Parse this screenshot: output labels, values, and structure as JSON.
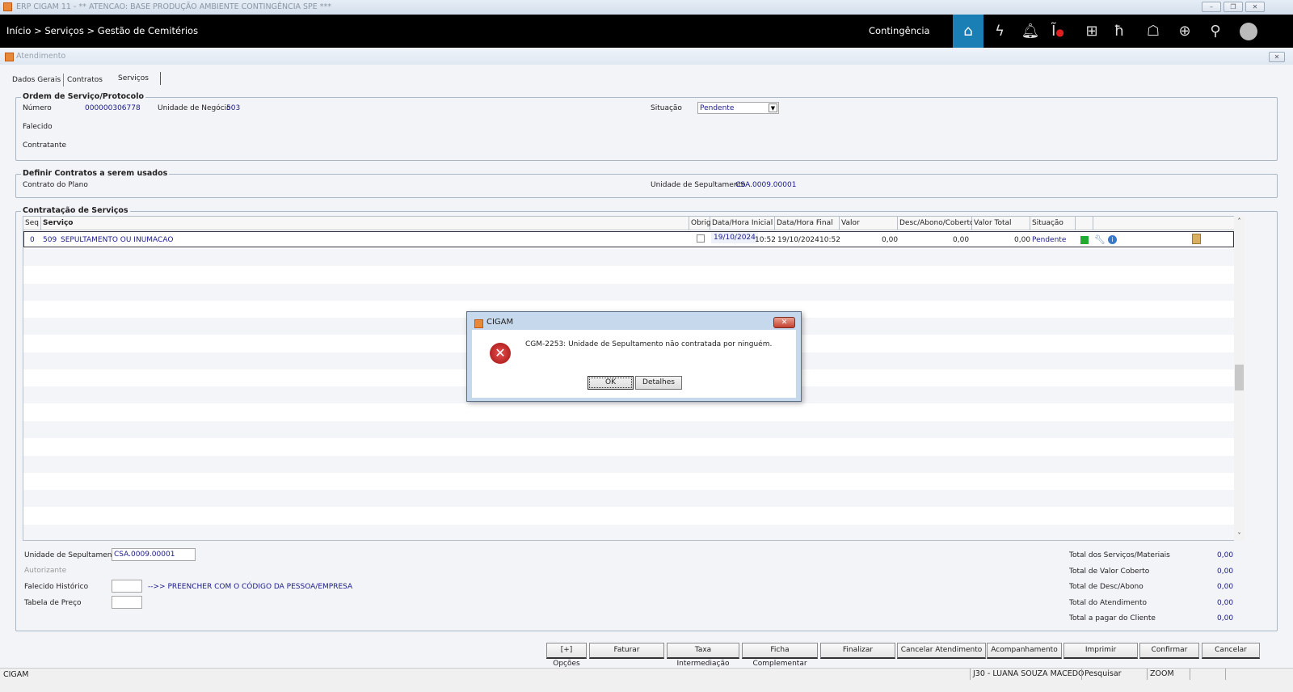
{
  "window": {
    "title": "ERP CIGAM 11 - ** ATENCAO: BASE PRODUÇÃO AMBIENTE CONTINGÊNCIA SPE ***"
  },
  "header": {
    "breadcrumb": "Início > Serviços > Gestão de Cemitérios",
    "environment": "Contingência"
  },
  "form": {
    "title": "Atendimento",
    "tabs": [
      "Dados Gerais",
      "Contratos",
      "Serviços"
    ]
  },
  "ordem": {
    "legend": "Ordem de Serviço/Protocolo",
    "numero_label": "Número",
    "numero": "000000306778",
    "unidade_label": "Unidade de Negócio",
    "unidade": "503",
    "situacao_label": "Situação",
    "situacao": "Pendente",
    "falecido_label": "Falecido",
    "contratante_label": "Contratante"
  },
  "contratos": {
    "legend": "Definir Contratos a serem usados",
    "plano_label": "Contrato do Plano",
    "unidade_label": "Unidade de Sepultamento",
    "unidade": "CSA.0009.00001"
  },
  "servicos": {
    "legend": "Contratação de Serviços",
    "columns": [
      "Seq",
      "Serviço",
      "Obrig",
      "Data/Hora Inicial",
      "Data/Hora Final",
      "Valor",
      "Desc/Abono/Coberto",
      "Valor Total Item",
      "Situação"
    ],
    "rows": [
      {
        "seq": "0",
        "codigo": "509",
        "servico": "SEPULTAMENTO OU INUMACAO",
        "data_ini": "19/10/2024",
        "hora_ini": "10:52",
        "data_fim": "19/10/2024",
        "hora_fim": "10:52",
        "valor": "0,00",
        "desc": "0,00",
        "total": "0,00",
        "situacao": "Pendente",
        "status_color": "#22aa33"
      }
    ]
  },
  "bottom": {
    "unidade_label": "Unidade de Sepultamento",
    "unidade": "CSA.0009.00001",
    "autorizante_label": "Autorizante",
    "falecido_hist_label": "Falecido Histórico",
    "hint": "-->> PREENCHER COM O CÓDIGO DA PESSOA/EMPRESA",
    "tabela_label": "Tabela de Preço"
  },
  "totals": [
    {
      "label": "Total dos Serviços/Materiais",
      "value": "0,00"
    },
    {
      "label": "Total de Valor Coberto",
      "value": "0,00"
    },
    {
      "label": "Total de Desc/Abono",
      "value": "0,00"
    },
    {
      "label": "Total do Atendimento",
      "value": "0,00"
    },
    {
      "label": "Total a pagar do Cliente",
      "value": "0,00"
    }
  ],
  "buttons": [
    "[+] Opções",
    "Faturar",
    "Taxa Intermediação",
    "Ficha Complementar",
    "Finalizar",
    "Cancelar Atendimento",
    "Acompanhamento",
    "Imprimir",
    "Confirmar",
    "Cancelar"
  ],
  "statusbar": {
    "app": "CIGAM",
    "user": "J30 - LUANA SOUZA MACEDO",
    "search": "Pesquisar",
    "zoom": "ZOOM"
  },
  "dialog": {
    "title": "CIGAM",
    "message": "CGM-2253: Unidade de Sepultamento não contratada por ninguém.",
    "ok": "OK",
    "details": "Detalhes"
  }
}
